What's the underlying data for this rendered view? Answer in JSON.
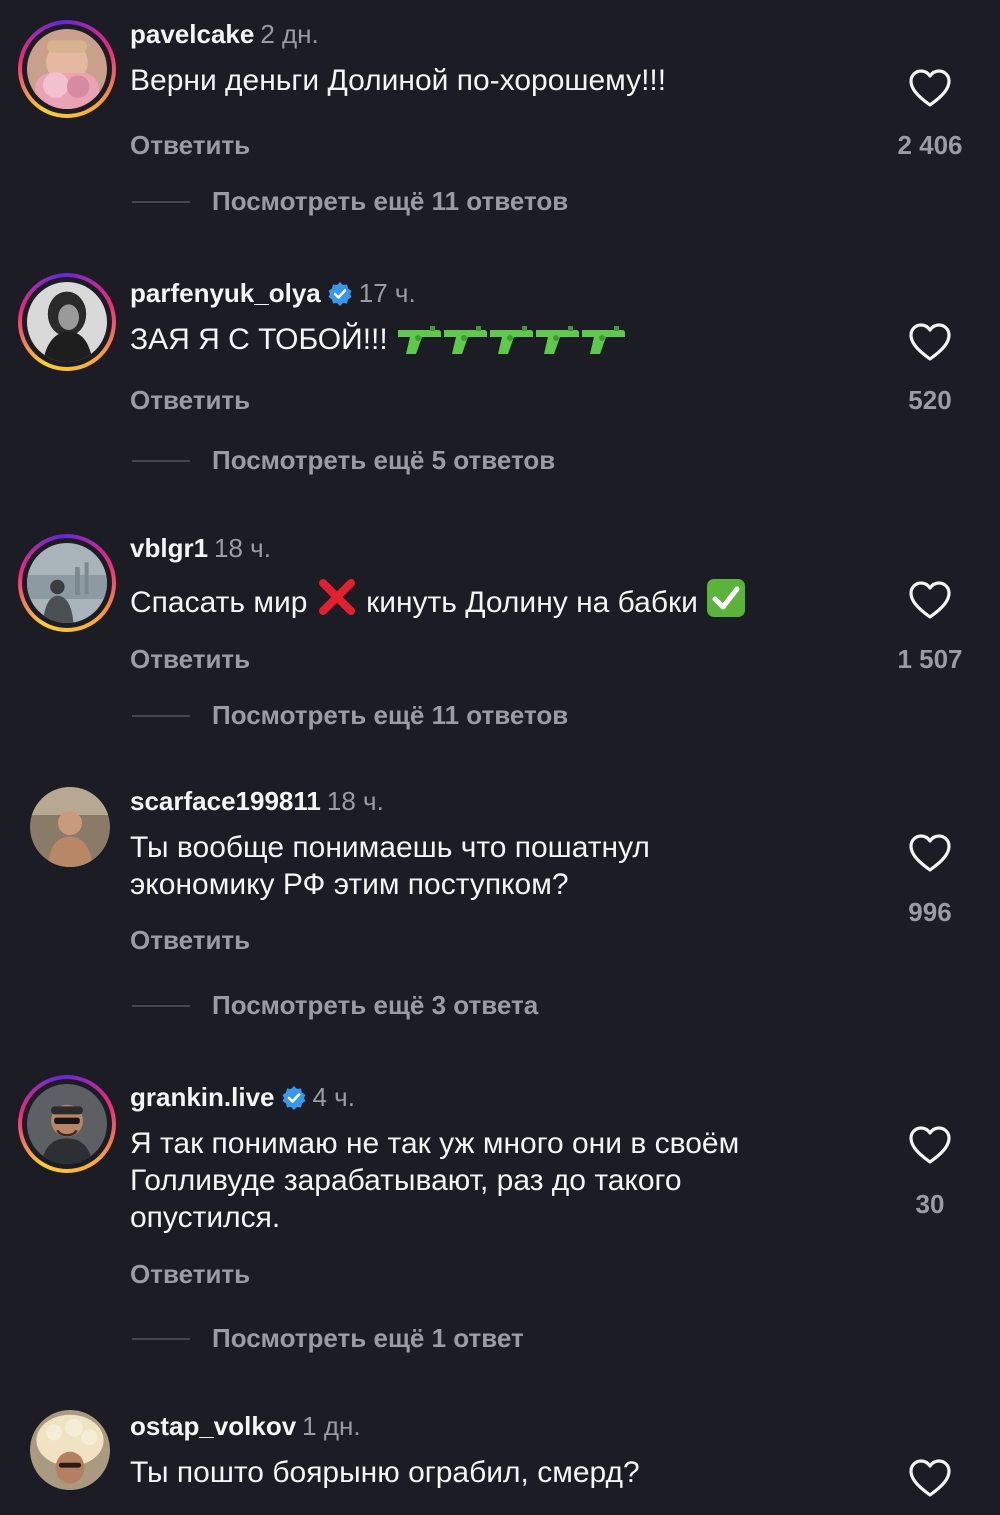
{
  "comments": [
    {
      "username": "pavelcake",
      "time": "2 дн.",
      "text": "Верни деньги Долиной по-хорошему!!!",
      "reply_label": "Ответить",
      "likes": "2 406",
      "more": "Посмотреть ещё 11 ответов",
      "verified": false
    },
    {
      "username": "parfenyuk_olya",
      "time": "17 ч.",
      "text": "ЗАЯ Я С ТОБОЙ!!!",
      "emoji": [
        "water-pistol-icon",
        "water-pistol-icon",
        "water-pistol-icon",
        "water-pistol-icon",
        "water-pistol-icon"
      ],
      "reply_label": "Ответить",
      "likes": "520",
      "more": "Посмотреть ещё 5 ответов",
      "verified": true
    },
    {
      "username": "vblgr1",
      "time": "18 ч.",
      "text_a": "Спасать мир",
      "text_b": "кинуть Долину на бабки",
      "emoji": [
        "cross-mark-icon",
        "check-mark-button-icon"
      ],
      "reply_label": "Ответить",
      "likes": "1 507",
      "more": "Посмотреть ещё 11 ответов",
      "verified": false
    },
    {
      "username": "scarface199811",
      "time": "18 ч.",
      "text_line1": "Ты вообще понимаешь что пошатнул",
      "text_line2": "экономику РФ этим поступком?",
      "reply_label": "Ответить",
      "likes": "996",
      "more": "Посмотреть ещё 3 ответа",
      "verified": false
    },
    {
      "username": "grankin.live",
      "time": "4 ч.",
      "text_line1": "Я так понимаю не так уж много они в своём",
      "text_line2": "Голливуде зарабатывают, раз до такого",
      "text_line3": "опустился.",
      "reply_label": "Ответить",
      "likes": "30",
      "more": "Посмотреть ещё 1 ответ",
      "verified": true
    },
    {
      "username": "ostap_volkov",
      "time": "1 дн.",
      "text": "Ты пошто боярыню ограбил, смерд?",
      "verified": false
    }
  ],
  "colors": {
    "background": "#1c1d24",
    "text": "#f4f4f6",
    "muted": "#9a9ba3",
    "verified": "#3897f0"
  }
}
